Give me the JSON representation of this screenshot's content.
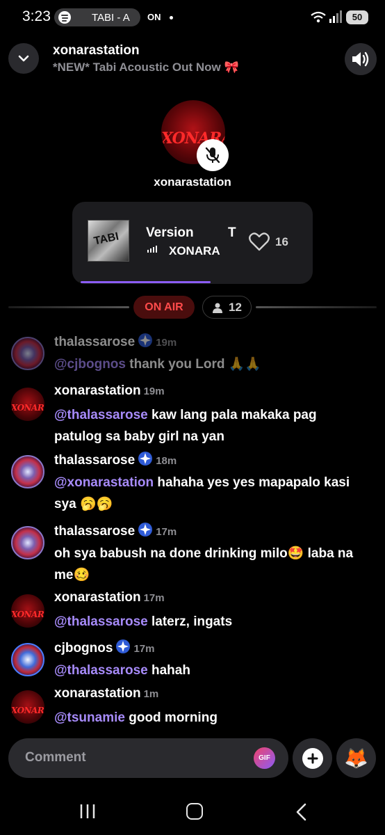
{
  "status_bar": {
    "time": "3:23",
    "media_pill_text": "TABI - A",
    "media_app_icon": "spotify-icon",
    "on_label": "ON",
    "battery": "50",
    "wifi_badge": "5"
  },
  "header": {
    "station_name": "xonarastation",
    "subtitle": "*NEW* Tabi Acoustic Out Now 🎀",
    "collapse_icon": "chevron-down-icon",
    "volume_icon": "speaker-icon"
  },
  "host": {
    "avatar_logo": "XONARA",
    "name": "xonarastation",
    "mute_icon": "microphone-muted-icon"
  },
  "now_playing": {
    "title": "Version",
    "title_overflow": "T",
    "artist": "XONARA",
    "art_text": "TABI",
    "likes": "16",
    "progress": 0.58,
    "heart_icon": "heart-outline-icon"
  },
  "live": {
    "on_air_label": "ON AIR",
    "listener_count": "12",
    "listener_icon": "person-icon"
  },
  "comments": [
    {
      "user": "thalassarose",
      "verified": true,
      "time": "19m",
      "mention": "@cjbognos",
      "text": " thank you Lord 🙏🙏",
      "avatar": "thalassarose-avatar"
    },
    {
      "user": "xonarastation",
      "verified": false,
      "time": "19m",
      "mention": "@thalassarose",
      "text": " kaw lang pala makaka pag patulog sa baby girl na yan",
      "avatar": "xonarastation-avatar"
    },
    {
      "user": "thalassarose",
      "verified": true,
      "time": "18m",
      "mention": "@xonarastation",
      "text": " hahaha yes yes mapapalo kasi sya 🥱🥱",
      "avatar": "thalassarose-avatar"
    },
    {
      "user": "thalassarose",
      "verified": true,
      "time": "17m",
      "mention": "",
      "text": "oh sya babush na done drinking milo🤩 laba na me🥴",
      "avatar": "thalassarose-avatar"
    },
    {
      "user": "xonarastation",
      "verified": false,
      "time": "17m",
      "mention": "@thalassarose",
      "text": " laterz, ingats",
      "avatar": "xonarastation-avatar"
    },
    {
      "user": "cjbognos",
      "verified": true,
      "time": "17m",
      "mention": "@thalassarose",
      "text": " hahah",
      "avatar": "cjbognos-avatar"
    },
    {
      "user": "xonarastation",
      "verified": false,
      "time": "1m",
      "mention": "@tsunamie",
      "text": " good morning",
      "avatar": "xonarastation-avatar"
    }
  ],
  "composer": {
    "placeholder": "Comment",
    "gif_label": "GIF",
    "add_icon": "plus-icon",
    "emoji_icon": "fox-emoji-icon",
    "emoji": "🦊"
  },
  "navbar": {
    "recents_icon": "recents-icon",
    "home_icon": "home-icon",
    "back_icon": "back-icon"
  },
  "colors": {
    "background": "#000000",
    "accent": "#8b5cf6",
    "mention": "#a78bfa",
    "on_air": "#ff4b4b"
  }
}
